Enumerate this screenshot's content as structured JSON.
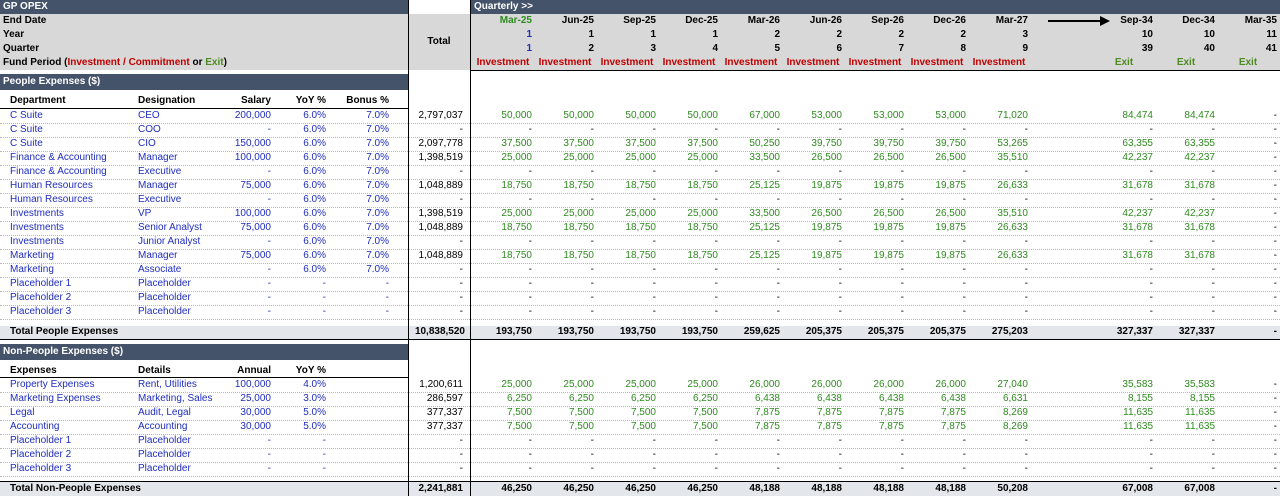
{
  "title": "GP OPEX",
  "period_label": "Quarterly >>",
  "total_header": "Total",
  "row_labels": {
    "end_date": "End Date",
    "year": "Year",
    "quarter": "Quarter",
    "fund_period_prefix": "Fund Period (",
    "fund_period_inv": "Investment / Commitment",
    "fund_period_or": " or ",
    "fund_period_exit": "Exit",
    "fund_period_suffix": ")"
  },
  "timeline": {
    "dates": [
      "Mar-25",
      "Jun-25",
      "Sep-25",
      "Dec-25",
      "Mar-26",
      "Jun-26",
      "Sep-26",
      "Dec-26",
      "Mar-27",
      "Sep-34",
      "Dec-34",
      "Mar-35"
    ],
    "years": [
      "1",
      "1",
      "1",
      "1",
      "2",
      "2",
      "2",
      "2",
      "3",
      "10",
      "10",
      "11"
    ],
    "quarters": [
      "1",
      "2",
      "3",
      "4",
      "5",
      "6",
      "7",
      "8",
      "9",
      "39",
      "40",
      "41"
    ],
    "periods": [
      "Investment",
      "Investment",
      "Investment",
      "Investment",
      "Investment",
      "Investment",
      "Investment",
      "Investment",
      "Investment",
      "Exit",
      "Exit",
      "Exit"
    ]
  },
  "people": {
    "section_title": "People Expenses ($)",
    "headers": [
      "Department",
      "Designation",
      "Salary",
      "YoY %",
      "Bonus %"
    ],
    "rows": [
      {
        "dept": "C Suite",
        "desig": "CEO",
        "salary": "200,000",
        "yoy": "6.0%",
        "bonus": "7.0%",
        "total": "2,797,037",
        "vals": [
          "50,000",
          "50,000",
          "50,000",
          "50,000",
          "67,000",
          "53,000",
          "53,000",
          "53,000",
          "71,020",
          "84,474",
          "84,474",
          "-"
        ]
      },
      {
        "dept": "C Suite",
        "desig": "COO",
        "salary": "-",
        "yoy": "6.0%",
        "bonus": "7.0%",
        "total": "-",
        "vals": [
          "-",
          "-",
          "-",
          "-",
          "-",
          "-",
          "-",
          "-",
          "-",
          "-",
          "-",
          "-"
        ]
      },
      {
        "dept": "C Suite",
        "desig": "CIO",
        "salary": "150,000",
        "yoy": "6.0%",
        "bonus": "7.0%",
        "total": "2,097,778",
        "vals": [
          "37,500",
          "37,500",
          "37,500",
          "37,500",
          "50,250",
          "39,750",
          "39,750",
          "39,750",
          "53,265",
          "63,355",
          "63,355",
          "-"
        ]
      },
      {
        "dept": "Finance & Accounting",
        "desig": "Manager",
        "salary": "100,000",
        "yoy": "6.0%",
        "bonus": "7.0%",
        "total": "1,398,519",
        "vals": [
          "25,000",
          "25,000",
          "25,000",
          "25,000",
          "33,500",
          "26,500",
          "26,500",
          "26,500",
          "35,510",
          "42,237",
          "42,237",
          "-"
        ]
      },
      {
        "dept": "Finance & Accounting",
        "desig": "Executive",
        "salary": "-",
        "yoy": "6.0%",
        "bonus": "7.0%",
        "total": "-",
        "vals": [
          "-",
          "-",
          "-",
          "-",
          "-",
          "-",
          "-",
          "-",
          "-",
          "-",
          "-",
          "-"
        ]
      },
      {
        "dept": "Human Resources",
        "desig": "Manager",
        "salary": "75,000",
        "yoy": "6.0%",
        "bonus": "7.0%",
        "total": "1,048,889",
        "vals": [
          "18,750",
          "18,750",
          "18,750",
          "18,750",
          "25,125",
          "19,875",
          "19,875",
          "19,875",
          "26,633",
          "31,678",
          "31,678",
          "-"
        ]
      },
      {
        "dept": "Human Resources",
        "desig": "Executive",
        "salary": "-",
        "yoy": "6.0%",
        "bonus": "7.0%",
        "total": "-",
        "vals": [
          "-",
          "-",
          "-",
          "-",
          "-",
          "-",
          "-",
          "-",
          "-",
          "-",
          "-",
          "-"
        ]
      },
      {
        "dept": "Investments",
        "desig": "VP",
        "salary": "100,000",
        "yoy": "6.0%",
        "bonus": "7.0%",
        "total": "1,398,519",
        "vals": [
          "25,000",
          "25,000",
          "25,000",
          "25,000",
          "33,500",
          "26,500",
          "26,500",
          "26,500",
          "35,510",
          "42,237",
          "42,237",
          "-"
        ]
      },
      {
        "dept": "Investments",
        "desig": "Senior Analyst",
        "salary": "75,000",
        "yoy": "6.0%",
        "bonus": "7.0%",
        "total": "1,048,889",
        "vals": [
          "18,750",
          "18,750",
          "18,750",
          "18,750",
          "25,125",
          "19,875",
          "19,875",
          "19,875",
          "26,633",
          "31,678",
          "31,678",
          "-"
        ]
      },
      {
        "dept": "Investments",
        "desig": "Junior Analyst",
        "salary": "-",
        "yoy": "6.0%",
        "bonus": "7.0%",
        "total": "-",
        "vals": [
          "-",
          "-",
          "-",
          "-",
          "-",
          "-",
          "-",
          "-",
          "-",
          "-",
          "-",
          "-"
        ]
      },
      {
        "dept": "Marketing",
        "desig": "Manager",
        "salary": "75,000",
        "yoy": "6.0%",
        "bonus": "7.0%",
        "total": "1,048,889",
        "vals": [
          "18,750",
          "18,750",
          "18,750",
          "18,750",
          "25,125",
          "19,875",
          "19,875",
          "19,875",
          "26,633",
          "31,678",
          "31,678",
          "-"
        ]
      },
      {
        "dept": "Marketing",
        "desig": "Associate",
        "salary": "-",
        "yoy": "6.0%",
        "bonus": "7.0%",
        "total": "-",
        "vals": [
          "-",
          "-",
          "-",
          "-",
          "-",
          "-",
          "-",
          "-",
          "-",
          "-",
          "-",
          "-"
        ]
      },
      {
        "dept": "Placeholder 1",
        "desig": "Placeholder",
        "salary": "-",
        "yoy": "-",
        "bonus": "-",
        "total": "-",
        "vals": [
          "-",
          "-",
          "-",
          "-",
          "-",
          "-",
          "-",
          "-",
          "-",
          "-",
          "-",
          "-"
        ]
      },
      {
        "dept": "Placeholder 2",
        "desig": "Placeholder",
        "salary": "-",
        "yoy": "-",
        "bonus": "-",
        "total": "-",
        "vals": [
          "-",
          "-",
          "-",
          "-",
          "-",
          "-",
          "-",
          "-",
          "-",
          "-",
          "-",
          "-"
        ]
      },
      {
        "dept": "Placeholder 3",
        "desig": "Placeholder",
        "salary": "-",
        "yoy": "-",
        "bonus": "-",
        "total": "-",
        "vals": [
          "-",
          "-",
          "-",
          "-",
          "-",
          "-",
          "-",
          "-",
          "-",
          "-",
          "-",
          "-"
        ]
      }
    ],
    "total_label": "Total People Expenses",
    "total": "10,838,520",
    "total_vals": [
      "193,750",
      "193,750",
      "193,750",
      "193,750",
      "259,625",
      "205,375",
      "205,375",
      "205,375",
      "275,203",
      "327,337",
      "327,337",
      "-"
    ]
  },
  "non_people": {
    "section_title": "Non-People Expenses ($)",
    "headers": [
      "Expenses",
      "Details",
      "Annual",
      "YoY %"
    ],
    "rows": [
      {
        "exp": "Property Expenses",
        "details": "Rent, Utilities",
        "annual": "100,000",
        "yoy": "4.0%",
        "total": "1,200,611",
        "vals": [
          "25,000",
          "25,000",
          "25,000",
          "25,000",
          "26,000",
          "26,000",
          "26,000",
          "26,000",
          "27,040",
          "35,583",
          "35,583",
          "-"
        ]
      },
      {
        "exp": "Marketing Expenses",
        "details": "Marketing, Sales",
        "annual": "25,000",
        "yoy": "3.0%",
        "total": "286,597",
        "vals": [
          "6,250",
          "6,250",
          "6,250",
          "6,250",
          "6,438",
          "6,438",
          "6,438",
          "6,438",
          "6,631",
          "8,155",
          "8,155",
          "-"
        ]
      },
      {
        "exp": "Legal",
        "details": "Audit, Legal",
        "annual": "30,000",
        "yoy": "5.0%",
        "total": "377,337",
        "vals": [
          "7,500",
          "7,500",
          "7,500",
          "7,500",
          "7,875",
          "7,875",
          "7,875",
          "7,875",
          "8,269",
          "11,635",
          "11,635",
          "-"
        ]
      },
      {
        "exp": "Accounting",
        "details": "Accounting",
        "annual": "30,000",
        "yoy": "5.0%",
        "total": "377,337",
        "vals": [
          "7,500",
          "7,500",
          "7,500",
          "7,500",
          "7,875",
          "7,875",
          "7,875",
          "7,875",
          "8,269",
          "11,635",
          "11,635",
          "-"
        ]
      },
      {
        "exp": "Placeholder 1",
        "details": "Placeholder",
        "annual": "-",
        "yoy": "-",
        "total": "-",
        "vals": [
          "-",
          "-",
          "-",
          "-",
          "-",
          "-",
          "-",
          "-",
          "-",
          "-",
          "-",
          "-"
        ]
      },
      {
        "exp": "Placeholder 2",
        "details": "Placeholder",
        "annual": "-",
        "yoy": "-",
        "total": "-",
        "vals": [
          "-",
          "-",
          "-",
          "-",
          "-",
          "-",
          "-",
          "-",
          "-",
          "-",
          "-",
          "-"
        ]
      },
      {
        "exp": "Placeholder 3",
        "details": "Placeholder",
        "annual": "-",
        "yoy": "-",
        "total": "-",
        "vals": [
          "-",
          "-",
          "-",
          "-",
          "-",
          "-",
          "-",
          "-",
          "-",
          "-",
          "-",
          "-"
        ]
      }
    ],
    "total_label": "Total Non-People Expenses",
    "total": "2,241,881",
    "total_vals": [
      "46,250",
      "46,250",
      "46,250",
      "46,250",
      "48,188",
      "48,188",
      "48,188",
      "48,188",
      "50,208",
      "67,008",
      "67,008",
      "-"
    ]
  }
}
